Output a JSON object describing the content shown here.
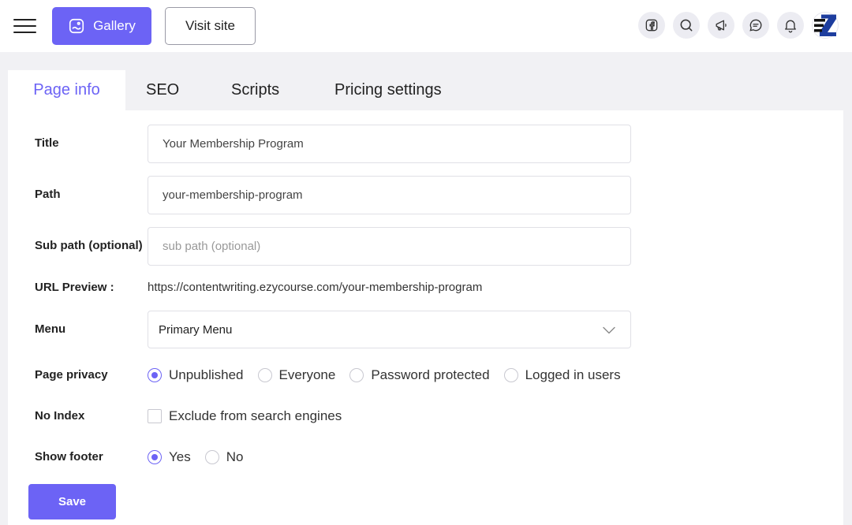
{
  "topbar": {
    "gallery_label": "Gallery",
    "visit_label": "Visit site",
    "icons": [
      "facebook-icon",
      "search-icon",
      "megaphone-icon",
      "chat-icon",
      "bell-icon"
    ]
  },
  "tabs": [
    {
      "label": "Page info",
      "active": true
    },
    {
      "label": "SEO",
      "active": false
    },
    {
      "label": "Scripts",
      "active": false
    },
    {
      "label": "Pricing settings",
      "active": false
    }
  ],
  "form": {
    "title": {
      "label": "Title",
      "value": "Your Membership Program"
    },
    "path": {
      "label": "Path",
      "value": "your-membership-program"
    },
    "subpath": {
      "label": "Sub path (optional)",
      "value": "",
      "placeholder": "sub path (optional)"
    },
    "url_preview": {
      "label": "URL Preview :",
      "value": "https://contentwriting.ezycourse.com/your-membership-program"
    },
    "menu": {
      "label": "Menu",
      "value": "Primary Menu"
    },
    "privacy": {
      "label": "Page privacy",
      "options": [
        "Unpublished",
        "Everyone",
        "Password protected",
        "Logged in users"
      ],
      "selected": "Unpublished"
    },
    "no_index": {
      "label": "No Index",
      "checkbox_label": "Exclude from search engines",
      "checked": false
    },
    "footer": {
      "label": "Show footer",
      "options": [
        "Yes",
        "No"
      ],
      "selected": "Yes"
    }
  },
  "save_label": "Save",
  "colors": {
    "accent": "#6c63f5",
    "background": "#f1f1f4"
  }
}
